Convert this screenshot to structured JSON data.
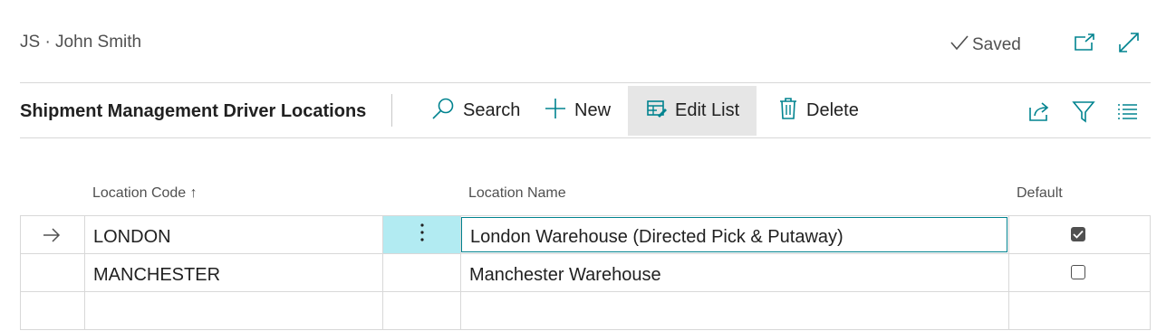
{
  "header": {
    "user": "JS · John Smith",
    "saved_label": "Saved",
    "open_new_window_icon": "open-in-new-window-icon",
    "expand_icon": "expand-icon"
  },
  "toolbar": {
    "title": "Shipment Management Driver Locations",
    "search_label": "Search",
    "new_label": "New",
    "edit_list_label": "Edit List",
    "delete_label": "Delete"
  },
  "table": {
    "columns": {
      "location_code": "Location Code",
      "sort_indicator": "↑",
      "location_name": "Location Name",
      "default": "Default"
    },
    "rows": [
      {
        "code": "LONDON",
        "name": "London Warehouse (Directed Pick & Putaway)",
        "default": true,
        "selected": true
      },
      {
        "code": "MANCHESTER",
        "name": "Manchester Warehouse",
        "default": false,
        "selected": false
      }
    ]
  },
  "colors": {
    "accent": "#00838f",
    "selected_cell": "#b2ebf2",
    "active_button": "#e6e6e6",
    "border": "#d8d8d8"
  }
}
